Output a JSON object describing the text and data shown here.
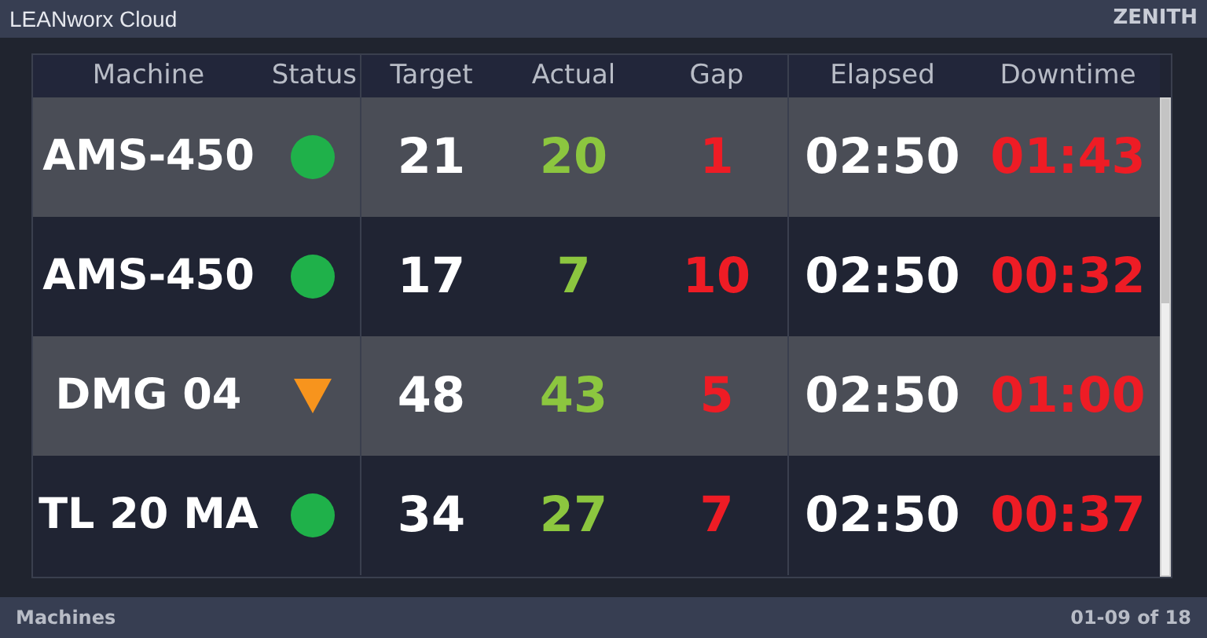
{
  "title_bar": {
    "app_name": "LEANworx Cloud",
    "company": "ZENITH"
  },
  "table": {
    "columns": [
      "Machine",
      "Status",
      "Target",
      "Actual",
      "Gap",
      "Elapsed",
      "Downtime"
    ],
    "rows": [
      {
        "machine": "AMS-450",
        "kind": "running",
        "target": "21",
        "actual": "20",
        "gap": "1",
        "elapsed": "02:50",
        "downtime": "01:43"
      },
      {
        "machine": "AMS-450",
        "kind": "running",
        "target": "17",
        "actual": "7",
        "gap": "10",
        "elapsed": "02:50",
        "downtime": "00:32"
      },
      {
        "machine": "DMG 04",
        "kind": "warning",
        "target": "48",
        "actual": "43",
        "gap": "5",
        "elapsed": "02:50",
        "downtime": "01:00"
      },
      {
        "machine": "TL 20 MA",
        "kind": "running",
        "target": "34",
        "actual": "27",
        "gap": "7",
        "elapsed": "02:50",
        "downtime": "00:37"
      }
    ]
  },
  "status_bar": {
    "section": "Machines",
    "page_range": "01-09 of 18"
  }
}
